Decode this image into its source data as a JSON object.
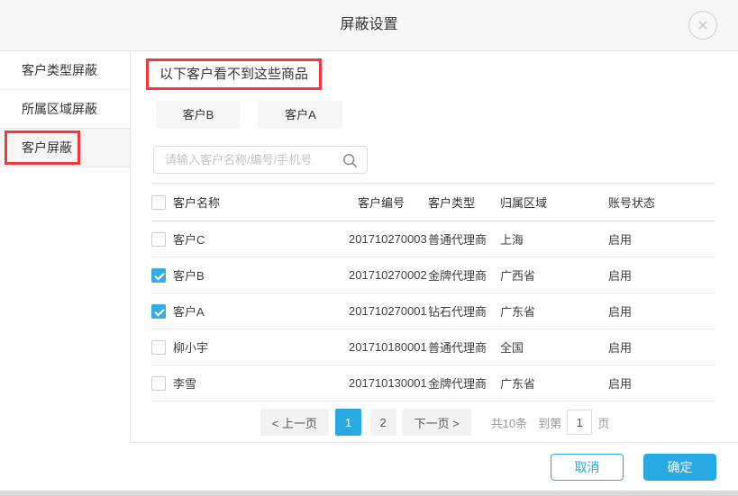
{
  "modal": {
    "title": "屏蔽设置"
  },
  "icons": {
    "close": "close-icon",
    "search": "search-icon"
  },
  "colors": {
    "accent_blue": "#29a9e1",
    "checkbox_blue": "#36ade4",
    "annotation_red": "#f2383b"
  },
  "sidebar": {
    "items": [
      {
        "label": "客户类型屏蔽",
        "active": false,
        "annotated": false
      },
      {
        "label": "所属区域屏蔽",
        "active": false,
        "annotated": false
      },
      {
        "label": "客户屏蔽",
        "active": true,
        "annotated": true
      }
    ]
  },
  "main": {
    "section_title": "以下客户看不到这些商品",
    "tags": [
      "客户B",
      "客户A"
    ],
    "search": {
      "placeholder": "请输入客户名称/编号/手机号"
    },
    "table": {
      "columns": [
        "客户名称",
        "客户编号",
        "客户类型",
        "归属区域",
        "账号状态"
      ],
      "rows": [
        {
          "checked": false,
          "name": "客户C",
          "code": "201710270003",
          "type": "普通代理商",
          "region": "上海",
          "status": "启用"
        },
        {
          "checked": true,
          "name": "客户B",
          "code": "201710270002",
          "type": "金牌代理商",
          "region": "广西省",
          "status": "启用"
        },
        {
          "checked": true,
          "name": "客户A",
          "code": "201710270001",
          "type": "钻石代理商",
          "region": "广东省",
          "status": "启用"
        },
        {
          "checked": false,
          "name": "柳小宇",
          "code": "201710180001",
          "type": "普通代理商",
          "region": "全国",
          "status": "启用"
        },
        {
          "checked": false,
          "name": "李雪",
          "code": "201710130001",
          "type": "金牌代理商",
          "region": "广东省",
          "status": "启用"
        }
      ]
    },
    "pagination": {
      "prev_label": "< 上一页",
      "pages": [
        {
          "label": "1",
          "active": true
        },
        {
          "label": "2",
          "active": false
        }
      ],
      "next_label": "下一页 >",
      "total_label": "共10条",
      "goto_prefix": "到第",
      "goto_value": "1",
      "goto_suffix": "页"
    }
  },
  "footer": {
    "cancel_label": "取消",
    "confirm_label": "确定"
  }
}
